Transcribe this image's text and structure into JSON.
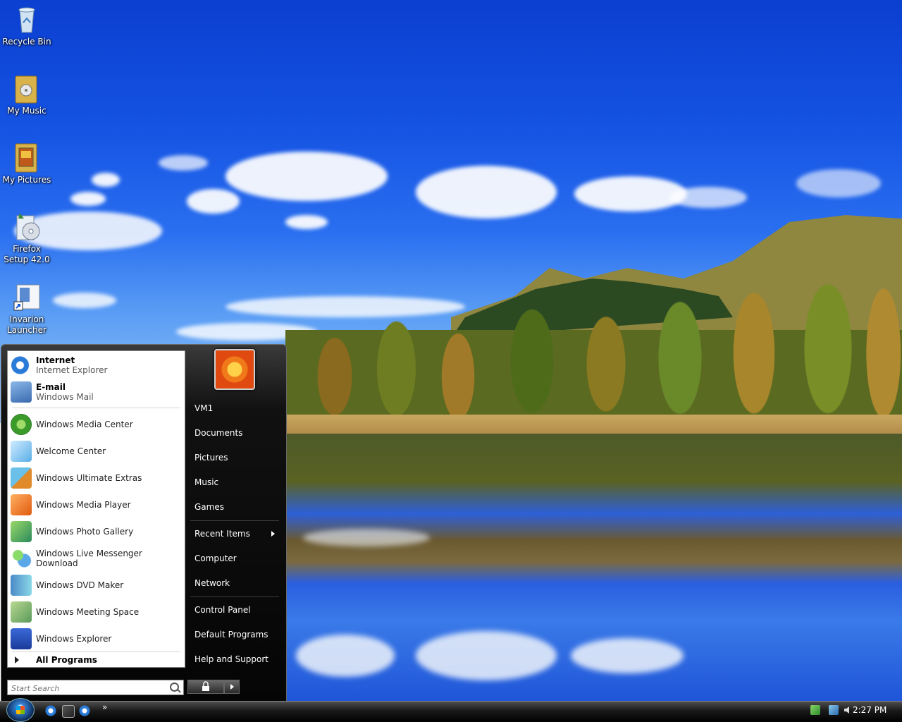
{
  "desktop": {
    "icons": [
      {
        "label": "Recycle Bin",
        "icon": "recycle-bin-icon"
      },
      {
        "label": "My Music",
        "icon": "music-folder-icon"
      },
      {
        "label": "My Pictures",
        "icon": "pictures-folder-icon"
      },
      {
        "label": "Firefox Setup 42.0",
        "icon": "installer-icon"
      },
      {
        "label": "Invarion Launcher",
        "icon": "shortcut-icon"
      }
    ]
  },
  "start_menu": {
    "pinned": [
      {
        "title": "Internet",
        "subtitle": "Internet Explorer",
        "icon": "internet-explorer-icon"
      },
      {
        "title": "E-mail",
        "subtitle": "Windows Mail",
        "icon": "windows-mail-icon"
      }
    ],
    "recent": [
      {
        "label": "Windows Media Center",
        "icon": "media-center-icon"
      },
      {
        "label": "Welcome Center",
        "icon": "welcome-center-icon"
      },
      {
        "label": "Windows Ultimate Extras",
        "icon": "ultimate-extras-icon"
      },
      {
        "label": "Windows Media Player",
        "icon": "media-player-icon"
      },
      {
        "label": "Windows Photo Gallery",
        "icon": "photo-gallery-icon"
      },
      {
        "label": "Windows Live Messenger Download",
        "icon": "messenger-icon"
      },
      {
        "label": "Windows DVD Maker",
        "icon": "dvd-maker-icon"
      },
      {
        "label": "Windows Meeting Space",
        "icon": "meeting-space-icon"
      },
      {
        "label": "Windows Explorer",
        "icon": "explorer-icon"
      }
    ],
    "all_programs": "All Programs",
    "search_placeholder": "Start Search",
    "right": {
      "user": "VM1",
      "documents": "Documents",
      "pictures": "Pictures",
      "music": "Music",
      "games": "Games",
      "recent_items": "Recent Items",
      "computer": "Computer",
      "network": "Network",
      "control_panel": "Control Panel",
      "default_programs": "Default Programs",
      "help": "Help and Support"
    }
  },
  "taskbar": {
    "clock": "2:27 PM",
    "quick_launch": [
      "internet-explorer-icon",
      "switch-windows-icon",
      "internet-explorer-icon"
    ],
    "overflow": "»"
  },
  "colors": {
    "taskbar": "#000000",
    "menu_dark": "#050505",
    "sky": "#1553e3"
  }
}
